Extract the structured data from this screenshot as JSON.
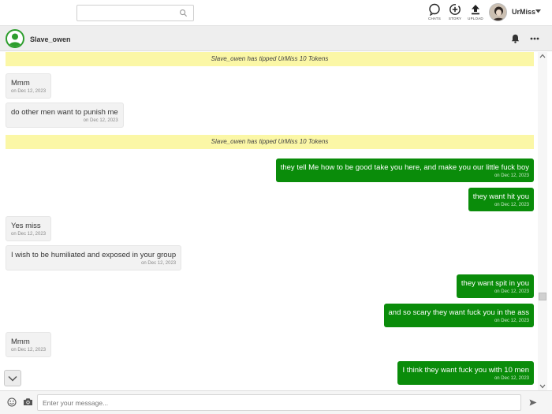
{
  "header": {
    "search": {
      "placeholder": "",
      "value": ""
    },
    "buttons": [
      {
        "label": "CHATS",
        "icon": "chat-bubble-icon"
      },
      {
        "label": "STORY",
        "icon": "story-add-icon"
      },
      {
        "label": "UPLOAD",
        "icon": "upload-icon"
      }
    ],
    "user": {
      "name": "UrMiss"
    }
  },
  "conversation": {
    "partner": "Slave_owen",
    "actions": [
      "bell-icon",
      "more-icon"
    ]
  },
  "messages": [
    {
      "kind": "tip",
      "text": "Slave_owen has tipped UrMiss 10 Tokens"
    },
    {
      "kind": "in",
      "text": "Mmm",
      "time": "on Dec 12, 2023"
    },
    {
      "kind": "in",
      "text": "do other men want to punish me",
      "time": "on Dec 12, 2023"
    },
    {
      "kind": "tip",
      "text": "Slave_owen has tipped UrMiss 10 Tokens"
    },
    {
      "kind": "out",
      "text": "they tell Me how to be good take you here, and make you our little fuck boy",
      "time": "on Dec 12, 2023"
    },
    {
      "kind": "out",
      "text": "they want hit you",
      "time": "on Dec 12, 2023"
    },
    {
      "kind": "in",
      "text": "Yes miss",
      "time": "on Dec 12, 2023"
    },
    {
      "kind": "in",
      "text": "I wish to be humiliated and exposed in your group",
      "time": "on Dec 12, 2023"
    },
    {
      "kind": "out",
      "text": "they want spit in you",
      "time": "on Dec 12, 2023"
    },
    {
      "kind": "out",
      "text": "and so scary they want fuck you in the ass",
      "time": "on Dec 12, 2023"
    },
    {
      "kind": "in",
      "text": "Mmm",
      "time": "on Dec 12, 2023"
    },
    {
      "kind": "out",
      "text": "I think they want fuck you with 10 men",
      "time": "on Dec 12, 2023"
    }
  ],
  "composer": {
    "placeholder": "Enter your message...",
    "icons": [
      "emoji-icon",
      "camera-icon",
      "send-icon"
    ]
  },
  "colors": {
    "outgoing_bubble": "#0a8c0a",
    "incoming_bubble": "#f2f2f2",
    "tip_banner": "#fbf7a6",
    "avatar_ring": "#2e9e2e"
  }
}
